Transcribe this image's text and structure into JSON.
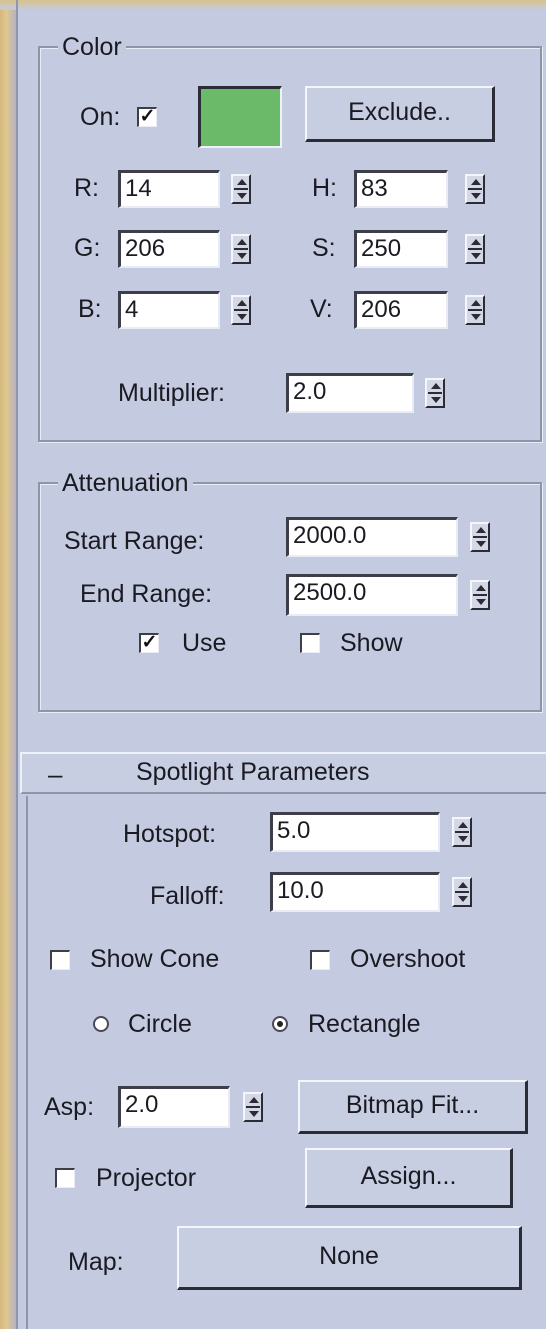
{
  "color": {
    "title": "Color",
    "on_label": "On:",
    "on_checked": true,
    "swatch_color": "#6bba6a",
    "exclude_button": "Exclude..",
    "r_label": "R:",
    "r_value": "14",
    "g_label": "G:",
    "g_value": "206",
    "b_label": "B:",
    "b_value": "4",
    "h_label": "H:",
    "h_value": "83",
    "s_label": "S:",
    "s_value": "250",
    "v_label": "V:",
    "v_value": "206",
    "multiplier_label": "Multiplier:",
    "multiplier_value": "2.0"
  },
  "attenuation": {
    "title": "Attenuation",
    "start_label": "Start Range:",
    "start_value": "2000.0",
    "end_label": "End Range:",
    "end_value": "2500.0",
    "use_label": "Use",
    "use_checked": true,
    "show_label": "Show",
    "show_checked": false
  },
  "spotlight": {
    "collapse_glyph": "–",
    "title": "Spotlight Parameters",
    "hotspot_label": "Hotspot:",
    "hotspot_value": "5.0",
    "falloff_label": "Falloff:",
    "falloff_value": "10.0",
    "show_cone_label": "Show Cone",
    "show_cone_checked": false,
    "overshoot_label": "Overshoot",
    "overshoot_checked": false,
    "circle_label": "Circle",
    "rectangle_label": "Rectangle",
    "selected_shape": "Rectangle",
    "asp_label": "Asp:",
    "asp_value": "2.0",
    "bitmap_fit_button": "Bitmap Fit...",
    "projector_label": "Projector",
    "projector_checked": false,
    "assign_button": "Assign...",
    "map_label": "Map:",
    "map_button": "None"
  }
}
